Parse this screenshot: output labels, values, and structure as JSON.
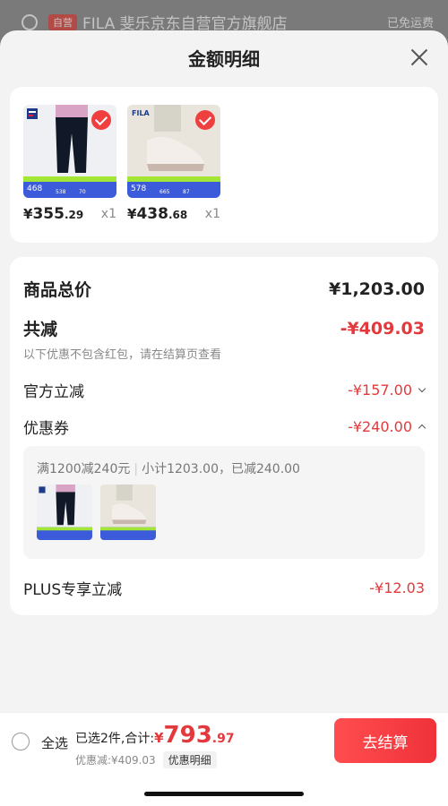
{
  "background": {
    "badge": "自营",
    "store_name": "FILA 斐乐京东自营官方旗舰店",
    "shipping": "已免运费"
  },
  "sheet": {
    "title": "金额明细"
  },
  "products": [
    {
      "price_yen": "¥",
      "price_int": "355",
      "price_dec": ".29",
      "qty": "x1",
      "promo_price": "468",
      "promo_a": "538",
      "promo_b": "70"
    },
    {
      "price_yen": "¥",
      "price_int": "438",
      "price_dec": ".68",
      "qty": "x1",
      "promo_price": "578",
      "promo_a": "665",
      "promo_b": "87"
    }
  ],
  "breakdown": {
    "total_label": "商品总价",
    "total_value": "¥1,203.00",
    "reduction_label": "共减",
    "reduction_value": "-¥409.03",
    "note": "以下优惠不包含红包，请在结算页查看",
    "official_label": "官方立减",
    "official_value": "-¥157.00",
    "coupon_label": "优惠券",
    "coupon_value": "-¥240.00",
    "coupon_rule": "满1200减240元",
    "coupon_summary": "小计1203.00，已减240.00",
    "plus_label": "PLUS专享立减",
    "plus_value": "-¥12.03"
  },
  "bottom": {
    "select_all": "全选",
    "selected_text": "已选2件,合计:",
    "total_yen": "¥",
    "total_int": "793",
    "total_dec": ".97",
    "discount_text": "优惠减:¥409.03",
    "detail_button": "优惠明细",
    "checkout_button": "去结算"
  },
  "colors": {
    "accent_red": "#e4393c",
    "checkout_gradient_start": "#ff4d4f",
    "checkout_gradient_end": "#f0323a"
  }
}
